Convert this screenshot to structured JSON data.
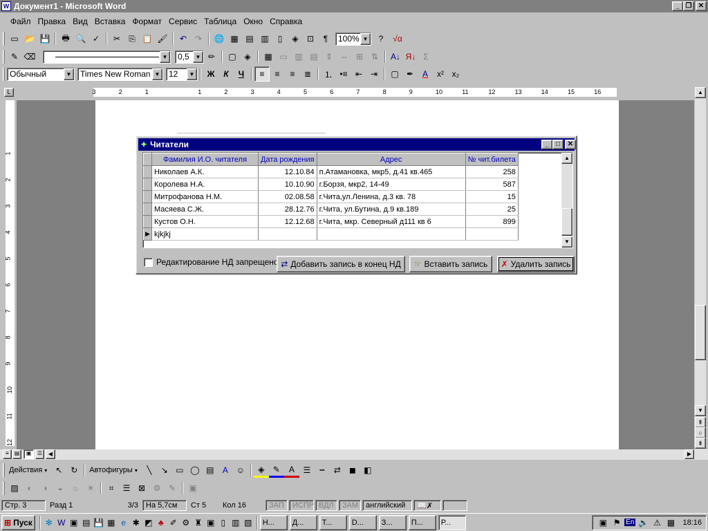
{
  "window": {
    "title": "Документ1 - Microsoft Word",
    "min_label": "_",
    "max_label": "❐",
    "close_label": "✕"
  },
  "menu": [
    "Файл",
    "Правка",
    "Вид",
    "Вставка",
    "Формат",
    "Сервис",
    "Таблица",
    "Окно",
    "Справка"
  ],
  "toolbar": {
    "zoom": "100%",
    "line_weight": "0,5",
    "style": "Обычный",
    "font": "Times New Roman",
    "size": "12",
    "bold": "Ж",
    "italic": "К",
    "underline": "Ч",
    "sum": "Σ",
    "pilcrow": "¶",
    "sqrt": "√α",
    "superscript": "x²",
    "subscript": "x₂"
  },
  "ruler": {
    "marks": [
      "3",
      "2",
      "1",
      "1",
      "2",
      "3",
      "4",
      "5",
      "6",
      "7",
      "8",
      "9",
      "10",
      "11",
      "12",
      "13",
      "14",
      "15",
      "16"
    ],
    "vmarks": [
      "1",
      "2",
      "3",
      "4",
      "5",
      "6",
      "7",
      "8",
      "9",
      "10",
      "11",
      "12"
    ]
  },
  "dialog": {
    "title": "Читатели",
    "columns": [
      "Фамилия И.О. читателя",
      "Дата рождения",
      "Адрес",
      "№ чит.билета"
    ],
    "rows": [
      [
        "Николаев А.К.",
        "12.10.84",
        "п.Атамановка, мкр5, д.41 кв.465",
        "258"
      ],
      [
        "Королева Н.А.",
        "10.10.90",
        "г.Борзя, мкр2, 14-49",
        "587"
      ],
      [
        "Митрофанова Н.М.",
        "02.08.58",
        "г.Чита,ул.Ленина,  д.3 кв. 78",
        "15"
      ],
      [
        "Масяева С.Ж.",
        "28.12.76",
        "г.Чита, ул.Бутина, д.9 кв.189",
        "25"
      ],
      [
        "Кустов О.Н.",
        "12.12.68",
        "г.Чита, мкр. Северный д111 кв 6",
        "899"
      ]
    ],
    "new_row": "kjkjkj",
    "checkbox_label": "Редактирование НД запрещено",
    "buttons": {
      "add": "Добавить запись в конец НД",
      "insert": "Вставить запись",
      "delete": "Удалить запись"
    }
  },
  "drawing": {
    "actions": "Действия",
    "autoshapes": "Автофигуры"
  },
  "status": {
    "page": "Стр. 3",
    "section": "Разд 1",
    "pages": "3/3",
    "at": "На 5,7см",
    "line": "Ст 5",
    "col": "Кол 16",
    "rec": "ЗАП",
    "trk": "ИСПР",
    "ext": "ВДЛ",
    "ovr": "ЗАМ",
    "lang": "английский"
  },
  "taskbar": {
    "start": "Пуск",
    "tasks": [
      "Н...",
      "Д...",
      "Т...",
      "D...",
      "З...",
      "П...",
      "Р..."
    ],
    "lang": "En",
    "clock": "18:16"
  }
}
